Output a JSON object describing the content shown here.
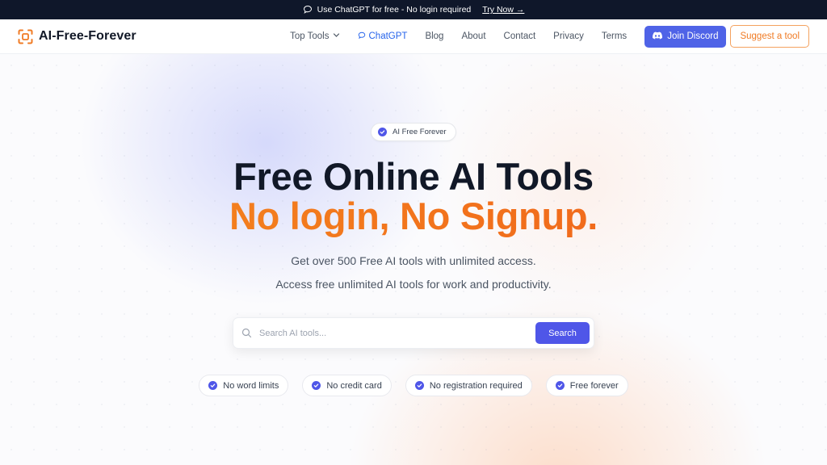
{
  "announcement": {
    "icon": "chat-bubble-icon",
    "text": "Use ChatGPT for free - No login required",
    "link_label": "Try Now →"
  },
  "brand": {
    "name": "AI-Free-Forever",
    "logo_icon": "scan-frame-logo",
    "accent_color": "#f07b24"
  },
  "nav": {
    "top_tools": "Top Tools",
    "chatgpt": "ChatGPT",
    "blog": "Blog",
    "about": "About",
    "contact": "Contact",
    "privacy": "Privacy",
    "terms": "Terms",
    "join_discord": "Join Discord",
    "suggest_tool": "Suggest a tool"
  },
  "hero": {
    "badge": "AI Free Forever",
    "title_line1": "Free Online AI Tools",
    "title_line2": "No login, No Signup.",
    "subtitle1": "Get over 500 Free AI tools with unlimited access.",
    "subtitle2": "Access free unlimited AI tools for work and productivity."
  },
  "search": {
    "placeholder": "Search AI tools...",
    "value": "",
    "button": "Search"
  },
  "features": [
    "No word limits",
    "No credit card",
    "No registration required",
    "Free forever"
  ],
  "colors": {
    "primary": "#4f56e8",
    "orange": "#f26a15",
    "dark": "#111827"
  }
}
